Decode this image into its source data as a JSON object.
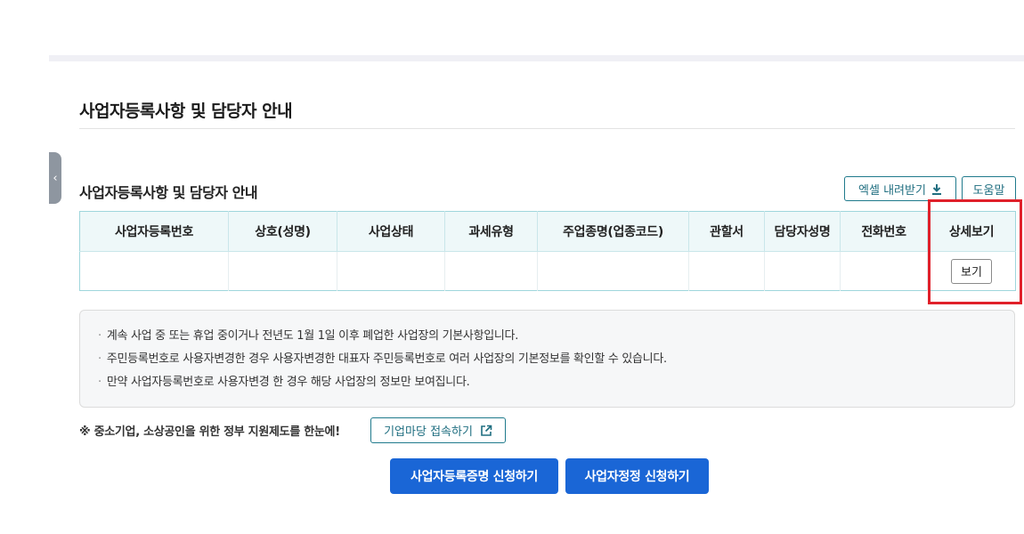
{
  "section": {
    "title": "사업자등록사항 및 담당자 안내"
  },
  "table": {
    "title": "사업자등록사항 및 담당자 안내",
    "excel_label": "엑셀 내려받기",
    "help_label": "도움말",
    "columns": [
      "사업자등록번호",
      "상호(성명)",
      "사업상태",
      "과세유형",
      "주업종명(업종코드)",
      "관할서",
      "담당자성명",
      "전화번호",
      "상세보기"
    ],
    "row": {
      "view_label": "보기"
    }
  },
  "notes": [
    "계속 사업 중 또는 휴업 중이거나 전년도 1월 1일 이후 폐업한 사업장의 기본사항입니다.",
    "주민등록번호로 사용자변경한 경우 사용자변경한 대표자 주민등록번호로 여러 사업장의 기본정보를 확인할 수 있습니다.",
    "만약 사업자등록번호로 사용자변경 한 경우 해당 사업장의 정보만 보여집니다."
  ],
  "gov": {
    "text": "※ 중소기업, 소상공인을 위한 정부 지원제도를 한눈에!",
    "link_label": "기업마당 접속하기"
  },
  "actions": {
    "cert_label": "사업자등록증명 신청하기",
    "correct_label": "사업자정정 신청하기"
  },
  "icons": {
    "side_tab": "chevron-left-icon",
    "excel": "download-icon",
    "gov_link": "external-link-icon"
  },
  "colors": {
    "primary": "#1a66d6",
    "teal": "#1f7a8c",
    "highlight": "#e0202a",
    "table_header_bg": "#eef8f9"
  }
}
